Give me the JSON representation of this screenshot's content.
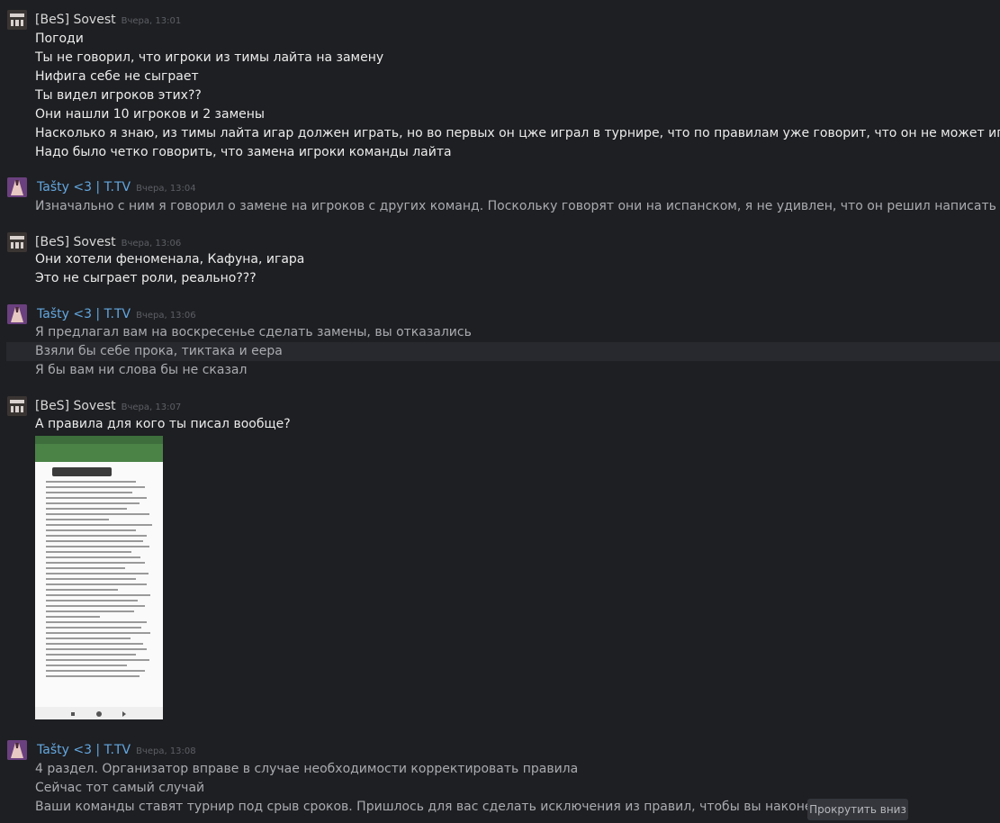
{
  "users": {
    "bes": {
      "name": "[BeS] Sovest",
      "avatar_icon": "bes-logo-avatar-icon"
    },
    "tasty": {
      "name": "Tašty <3 | T.TV",
      "avatar_icon": "user-avatar-icon"
    }
  },
  "groups": [
    {
      "time": "Вчера, 13:01",
      "messages": [
        "Погоди",
        "Ты не говорил, что игроки из тимы лайта на замену",
        "Нифига себе не сыграет",
        "Ты видел игроков этих??",
        "Они нашли 10 игроков и 2 замены",
        "Насколько я знаю, из тимы лайта игар должен играть, но во первых он цже играл в турнире, что по правилам уже говорит, что он не может играть за другую команд",
        "Надо было четко говорить, что замена игроки команды лайта"
      ]
    },
    {
      "time": "Вчера, 13:04",
      "messages": [
        "Изначально с ним я говорил о замене на игроков с других команд. Поскольку говорят они на испанском, я не удивлен, что он решил написать лайту"
      ]
    },
    {
      "time": "Вчера, 13:06",
      "messages": [
        "Они хотели феноменала, Кафуна, игара",
        "Это не сыграет роли, реально???"
      ]
    },
    {
      "time": "Вчера, 13:06",
      "messages": [
        "Я предлагал вам на воскресенье сделать замены, вы отказались",
        "Взяли бы себе прока, тиктака и еера",
        "Я бы вам ни слова бы не сказал"
      ]
    },
    {
      "time": "Вчера, 13:07",
      "messages": [
        "А правила для кого ты писал вообще?"
      ],
      "attachment": "phone-screenshot-image"
    },
    {
      "time": "Вчера, 13:08",
      "messages": [
        "4 раздел. Организатор вправе в случае необходимости корректировать правила",
        "Сейчас тот самый случай",
        "Ваши команды ставят турнир под срыв сроков. Пришлось для вас сделать исключения из правил, чтобы вы наконец выступили"
      ]
    }
  ],
  "scroll_button": "Прокрутить вниз"
}
